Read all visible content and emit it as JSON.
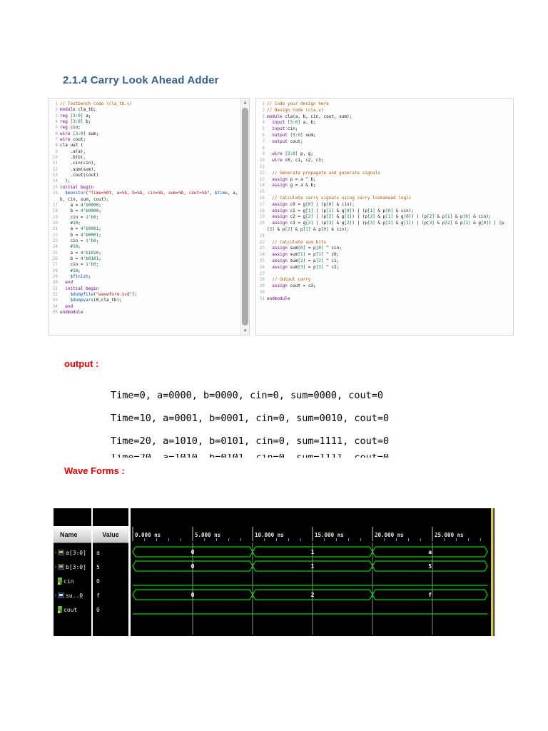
{
  "page": {
    "heading": "2.1.4 Carry Look Ahead  Adder"
  },
  "testbench_panel": {
    "lines": [
      "// Testbench Code (cla_tb.v)",
      "module cla_tb;",
      "reg [3:0] a;",
      "reg [3:0] b;",
      "reg cin;",
      "wire [3:0] sum;",
      "wire cout;",
      "cla uut (",
      "    .a(a),",
      "    .b(b),",
      "    .cin(cin),",
      "    .sum(sum),",
      "    .cout(cout)",
      "  );",
      "initial begin",
      "  $monitor(\"Time=%0t, a=%b, b=%b, cin=%b, sum=%b, cout=%b\", $time, a, b, cin, sum, cout);",
      "    a = 4'b0000;",
      "    b = 4'b0000;",
      "    cin = 1'b0;",
      "    #10;",
      "    a = 4'b0001;",
      "    b = 4'b0001;",
      "    cin = 1'b0;",
      "    #10;",
      "    a = 4'b1010;",
      "    b = 4'b0101;",
      "    cin = 1'b0;",
      "    #10;",
      "    $finish;",
      "  end",
      "  initial begin",
      "    $dumpfile(\"waveform.vcd\");",
      "    $dumpvars(0,cla_tb);",
      "  end",
      "endmodule"
    ]
  },
  "design_panel": {
    "lines": [
      "// Code your design here",
      "// Design Code (cla.v)",
      "module cla(a, b, cin, cout, sum);",
      "  input [3:0] a, b;",
      "  input cin;",
      "  output [3:0] sum;",
      "  output cout;",
      "",
      "  wire [3:0] p, g;",
      "  wire c0, c1, c2, c3;",
      "",
      "  // Generate propagate and generate signals",
      "  assign p = a ^ b;",
      "  assign g = a & b;",
      "",
      "  // Calculate carry signals using carry lookahead logic",
      "  assign c0 = g[0] | (p[0] & cin);",
      "  assign c1 = g[1] | (p[1] & g[0]) | (p[1] & p[0] & cin);",
      "  assign c2 = g[2] | (p[2] & g[1]) | (p[2] & p[1] & g[0]) | (p[2] & p[1] & p[0] & cin);",
      "  assign c3 = g[3] | (p[3] & g[2]) | (p[3] & p[2] & g[1]) | (p[3] & p[2] & p[1] & g[0]) | (p[3] & p[2] & p[1] & p[0] & cin);",
      "",
      "  // Calculate sum bits",
      "  assign sum[0] = p[0] ^ cin;",
      "  assign sum[1] = p[1] ^ c0;",
      "  assign sum[2] = p[2] ^ c1;",
      "  assign sum[3] = p[3] ^ c2;",
      "",
      "  // Output carry",
      "  assign cout = c3;",
      "",
      "endmodule"
    ]
  },
  "output_section": {
    "label": "output :",
    "lines": [
      "Time=0, a=0000, b=0000, cin=0, sum=0000, cout=0",
      "Time=10, a=0001, b=0001, cin=0, sum=0010, cout=0",
      "Time=20, a=1010, b=0101, cin=0, sum=1111, cout=0"
    ]
  },
  "waveform_section": {
    "label": "Wave Forms :"
  },
  "waveform": {
    "columns": {
      "name": "Name",
      "value": "Value"
    },
    "timeline": {
      "unit": "ns",
      "labels": [
        "0.000 ns",
        "5.000 ns",
        "10.000 ns",
        "15.000 ns",
        "20.000 ns",
        "25.000 ns"
      ],
      "times": [
        0,
        5,
        10,
        15,
        20,
        25
      ],
      "end_time": 29.6
    },
    "signals": [
      {
        "name": "a[3:0]",
        "value": "a",
        "kind": "bus",
        "icon": "bus-signal-icon",
        "segments": [
          {
            "from": 0,
            "to": 10,
            "label": "0"
          },
          {
            "from": 10,
            "to": 20,
            "label": "1"
          },
          {
            "from": 20,
            "to": 29.6,
            "label": "a"
          }
        ]
      },
      {
        "name": "b[3:0]",
        "value": "5",
        "kind": "bus",
        "icon": "bus-signal-icon",
        "segments": [
          {
            "from": 0,
            "to": 10,
            "label": "0"
          },
          {
            "from": 10,
            "to": 20,
            "label": "1"
          },
          {
            "from": 20,
            "to": 29.6,
            "label": "5"
          }
        ]
      },
      {
        "name": "cin",
        "value": "0",
        "kind": "bit",
        "icon": "bit-signal-icon",
        "level": 0
      },
      {
        "name": "su..0",
        "value": "f",
        "kind": "bus",
        "icon": "bus-signal-icon-white",
        "segments": [
          {
            "from": 0,
            "to": 10,
            "label": "0"
          },
          {
            "from": 10,
            "to": 20,
            "label": "2"
          },
          {
            "from": 20,
            "to": 29.6,
            "label": "f"
          }
        ]
      },
      {
        "name": "cout",
        "value": "0",
        "kind": "bit",
        "icon": "bit-signal-icon",
        "level": 0
      }
    ],
    "colors": {
      "wave_green": "#00d400",
      "background": "#000000",
      "grid": "#8f8f8f",
      "ruler_text": "#e8e8e8",
      "edge_stripe": "#d8ca45"
    }
  }
}
